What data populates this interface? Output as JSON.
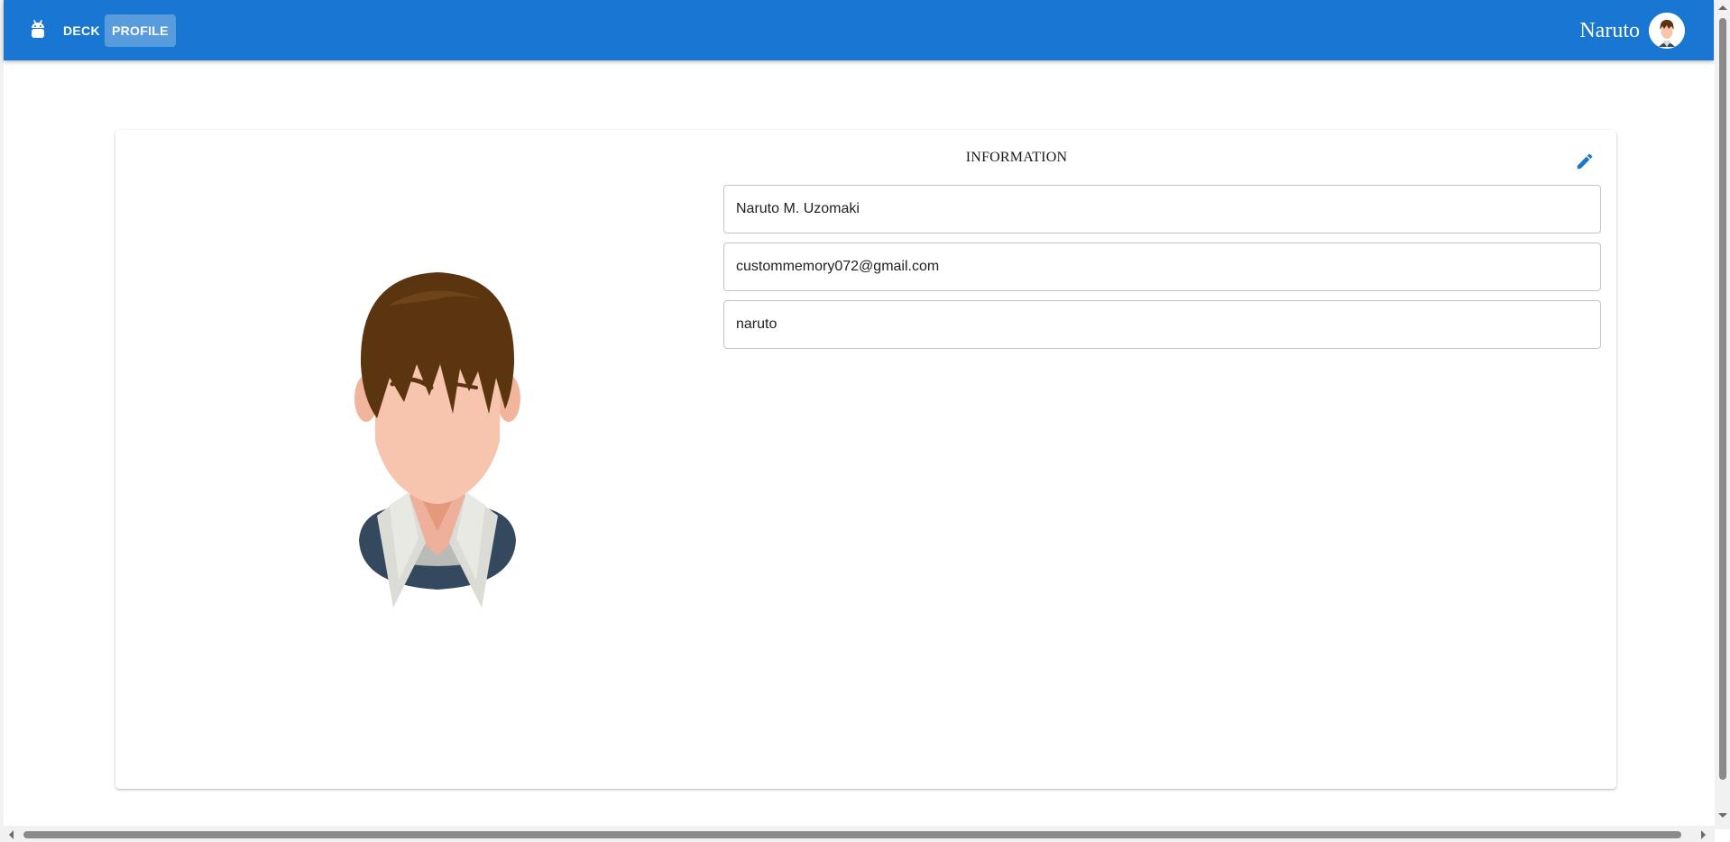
{
  "nav": {
    "items": [
      {
        "label": "DECK",
        "active": false
      },
      {
        "label": "PROFILE",
        "active": true
      }
    ],
    "logo_icon": "android-robot-icon"
  },
  "user": {
    "name": "Naruto",
    "avatar_icon": "user-avatar-icon"
  },
  "profile": {
    "section_title": "INFORMATION",
    "edit_icon": "pencil-icon",
    "portrait_icon": "anime-boy-portrait",
    "fields": [
      {
        "value": "Naruto M. Uzomaki"
      },
      {
        "value": "custommemory072@gmail.com"
      },
      {
        "value": "naruto"
      }
    ]
  },
  "colors": {
    "app_bar": "#1976d2",
    "accent": "#1976d2",
    "field_border": "#c4c4c4"
  }
}
